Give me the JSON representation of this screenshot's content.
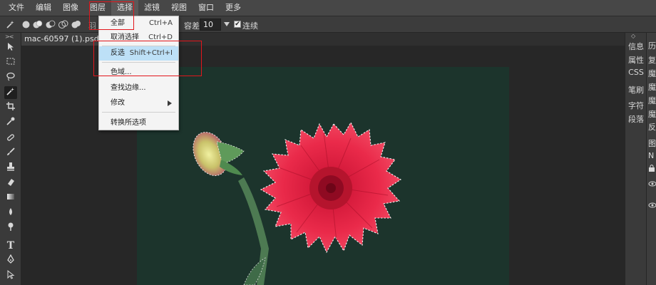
{
  "menubar": {
    "items": [
      "文件",
      "编辑",
      "图像",
      "图层",
      "选择",
      "滤镜",
      "视图",
      "窗口",
      "更多"
    ],
    "active_index": 4
  },
  "options": {
    "feather_label": "羽",
    "tolerance_label": "容差:",
    "tolerance_value": "10",
    "contiguous_checked": true,
    "contiguous_label": "连续"
  },
  "document": {
    "tab_title": "mac-60597 (1).psd",
    "tab_modified": "*",
    "tab_close": "×"
  },
  "select_menu": {
    "items": [
      {
        "label": "全部",
        "shortcut": "Ctrl+A"
      },
      {
        "label": "取消选择",
        "shortcut": "Ctrl+D"
      },
      {
        "label": "反选",
        "shortcut": "Shift+Ctrl+I",
        "highlighted": true
      },
      {
        "label": "色域..."
      },
      {
        "label": "查找边缘..."
      },
      {
        "label": "修改",
        "has_submenu": true
      },
      {
        "label": "转换所选项"
      }
    ]
  },
  "right_panel": {
    "items": [
      "信息",
      "属性",
      "CSS",
      "笔刷",
      "字符",
      "段落"
    ]
  },
  "right_panel_2": {
    "items": [
      "历",
      "复",
      "魔",
      "魔",
      "魔",
      "魔",
      "反",
      "图",
      "N"
    ]
  },
  "colors": {
    "annotation": "#e2161c",
    "canvas_bg": "#1c342c",
    "menu_highlight": "#bde0f7"
  }
}
